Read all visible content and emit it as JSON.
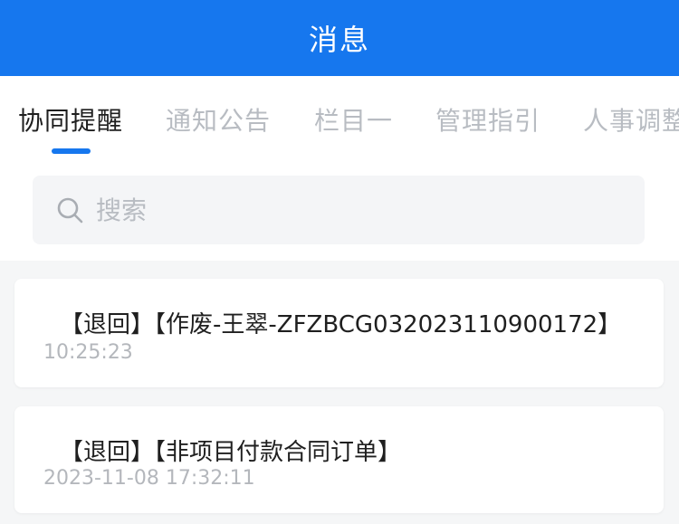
{
  "header": {
    "title": "消息"
  },
  "tabs": [
    {
      "label": "协同提醒",
      "active": true
    },
    {
      "label": "通知公告",
      "active": false
    },
    {
      "label": "栏目一",
      "active": false
    },
    {
      "label": "管理指引",
      "active": false
    },
    {
      "label": "人事调整",
      "active": false
    }
  ],
  "search": {
    "placeholder": "搜索",
    "icon": "search-icon"
  },
  "messages": [
    {
      "title": "【退回】【作废-王翠-ZFZBCG032023110900172】",
      "time": "10:25:23"
    },
    {
      "title": "【退回】【非项目付款合同订单】",
      "time": "2023-11-08 17:32:11"
    }
  ],
  "colors": {
    "brand": "#1677ee",
    "tab_inactive": "#b8bcc2",
    "time_text": "#b4b7bc"
  }
}
